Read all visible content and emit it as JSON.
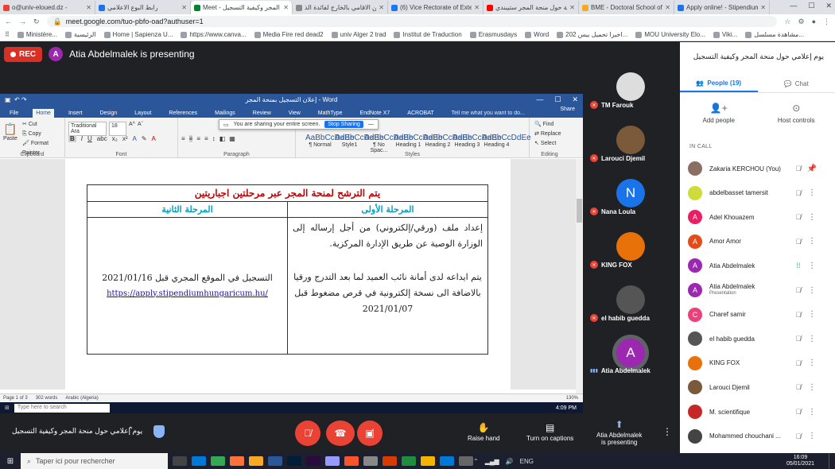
{
  "browser": {
    "tabs": [
      {
        "label": "o@univ-eloued.dz -",
        "color": "#ea4335"
      },
      {
        "label": "رابط البوع الاعلامي",
        "color": "#1a73e8"
      },
      {
        "label": "Meet - يوم إعلامي حول منحة المجر وكيفية التسجيل",
        "color": "#00832d",
        "active": true
      },
      {
        "label": "برنامج التكوين الاقامي بالخارج لفائدة الذ",
        "color": "#888"
      },
      {
        "label": "(6) Vice Rectorate of External Relation",
        "color": "#1877f2"
      },
      {
        "label": "معلومات عامة حول منحة المجر ستيبندي",
        "color": "#ff0000"
      },
      {
        "label": "BME - Doctoral School of Electrical En",
        "color": "#f9a825"
      },
      {
        "label": "Apply online! - Stipendium Hungaricum",
        "color": "#1a73e8"
      }
    ],
    "url": "meet.google.com/tuo-pbfo-oad?authuser=1",
    "bookmarks": [
      "Ministère...",
      "الرئيسية",
      "Home | Sapienza U...",
      "https://www.canva...",
      "Media Fire red dead2",
      "univ Alger 2 trad",
      "Institut de Traduction",
      "Erasmusdays",
      "Word",
      "اخيرا تحميل بيس 202...",
      "MOU University Elo...",
      "Viki...",
      "مشاهدة مسلسل..."
    ]
  },
  "meet": {
    "rec_label": "REC",
    "presenter_initial": "A",
    "presenting_text": "Atia Abdelmalek is presenting",
    "meeting_title": "يوم إعلامي حول منحة المجر وكيفية التسجيل",
    "controls": {
      "raise_hand": "Raise hand",
      "captions": "Turn on captions",
      "presenting_line1": "Atia Abdelmalek",
      "presenting_line2": "is presenting"
    },
    "tiles": [
      {
        "name": "TM Farouk",
        "initial": "",
        "color": "#ddd",
        "muted": true
      },
      {
        "name": "Larouci Djemil",
        "initial": "",
        "color": "#7a5a3a",
        "muted": true
      },
      {
        "name": "Nana Loula",
        "initial": "N",
        "color": "#1a73e8",
        "muted": true
      },
      {
        "name": "KING FOX",
        "initial": "",
        "color": "#e8710a",
        "muted": true
      },
      {
        "name": "el habib guedda",
        "initial": "",
        "color": "#555",
        "muted": true
      },
      {
        "name": "Atia Abdelmalek",
        "initial": "A",
        "color": "#9c27b0",
        "muted": false
      }
    ]
  },
  "panel": {
    "title": "يوم إعلامي حول منحة المجر وكيفية التسجيل",
    "people_tab": "People (19)",
    "chat_tab": "Chat",
    "add_people": "Add people",
    "host_controls": "Host controls",
    "in_call": "IN CALL",
    "participants": [
      {
        "name": "Zakaria KERCHOU (You)",
        "sub": "",
        "initial": "",
        "color": "#8d6e63"
      },
      {
        "name": "abdelbasset tamersit",
        "sub": "",
        "initial": "",
        "color": "#cddc39"
      },
      {
        "name": "Adel Khouazem",
        "sub": "",
        "initial": "A",
        "color": "#e91e63"
      },
      {
        "name": "Amor Amor",
        "sub": "",
        "initial": "A",
        "color": "#e64a19"
      },
      {
        "name": "Atia Abdelmalek",
        "sub": "",
        "initial": "A",
        "color": "#9c27b0"
      },
      {
        "name": "Atia Abdelmalek",
        "sub": "Presentation",
        "initial": "A",
        "color": "#9c27b0"
      },
      {
        "name": "Charef samir",
        "sub": "",
        "initial": "C",
        "color": "#ec407a"
      },
      {
        "name": "el habib guedda",
        "sub": "",
        "initial": "",
        "color": "#555"
      },
      {
        "name": "KING FOX",
        "sub": "",
        "initial": "",
        "color": "#e8710a"
      },
      {
        "name": "Larouci Djemil",
        "sub": "",
        "initial": "",
        "color": "#7a5a3a"
      },
      {
        "name": "M. scientifique",
        "sub": "",
        "initial": "",
        "color": "#c62828"
      },
      {
        "name": "Mohammed chouchani ...",
        "sub": "",
        "initial": "",
        "color": "#444"
      }
    ]
  },
  "word": {
    "title": "إعلان التسجيل بمنحة المجر - Word",
    "tabs": [
      "File",
      "Home",
      "Insert",
      "Design",
      "Layout",
      "References",
      "Mailings",
      "Review",
      "View",
      "MathType",
      "EndNote X7",
      "ACROBAT"
    ],
    "tell_me": "Tell me what you want to do...",
    "share": "Share",
    "share_notice": "You are sharing your entire screen.",
    "stop_sharing": "Stop Sharing",
    "clipboard": {
      "paste": "Paste",
      "cut": "Cut",
      "copy": "Copy",
      "format_painter": "Format Painter",
      "label": "Clipboard"
    },
    "font": {
      "name": "Traditional Ara",
      "size": "18",
      "label": "Font"
    },
    "paragraph_label": "Paragraph",
    "styles": [
      {
        "sample": "AaBbCcDdEe",
        "name": "¶ Normal"
      },
      {
        "sample": "AaBbCcDdEe",
        "name": "Style1"
      },
      {
        "sample": "AaBbCcDdEe",
        "name": "¶ No Spac..."
      },
      {
        "sample": "AaBbCcDdEe",
        "name": "Heading 1"
      },
      {
        "sample": "AaBbCcDdEe",
        "name": "Heading 2"
      },
      {
        "sample": "AaBbCcDdEe",
        "name": "Heading 3"
      },
      {
        "sample": "AaBbCcDdEe",
        "name": "Heading 4"
      }
    ],
    "styles_label": "Styles",
    "editing": {
      "find": "Find",
      "replace": "Replace",
      "select": "Select",
      "label": "Editing"
    },
    "table": {
      "header": "يتم الترشح لمنحة المجر عبر مرحلتين اجباريتين",
      "phase1": "المرحلة الأولى",
      "phase2": "المرحلة الثانية",
      "phase1_p1": "إعداد ملف (ورقي/إلكتروني) من أجل إرساله إلى الوزارة الوصية عن طريق الإدارة المركزية.",
      "phase1_p2": "يتم ايداعه لدى أمانة نائب العميد لما بعد التدرج ورقيا بالاضافة الى نسخة إلكترونية في قرص مضغوط قبل 2021/01/07",
      "phase2_p1": "التسجيل في الموقع المجري قبل 2021/01/16",
      "phase2_link": "https://apply.stipendiumhungaricum.hu/"
    },
    "status": {
      "page": "Page 1 of 3",
      "words": "302 words",
      "lang": "Arabic (Algeria)",
      "zoom": "130%"
    },
    "inner_taskbar": {
      "search": "Type here to search",
      "time": "4:09 PM"
    }
  },
  "taskbar": {
    "search": "Taper ici pour rechercher",
    "time": "16:09",
    "date": "05/01/2021",
    "lang": "ENG"
  }
}
